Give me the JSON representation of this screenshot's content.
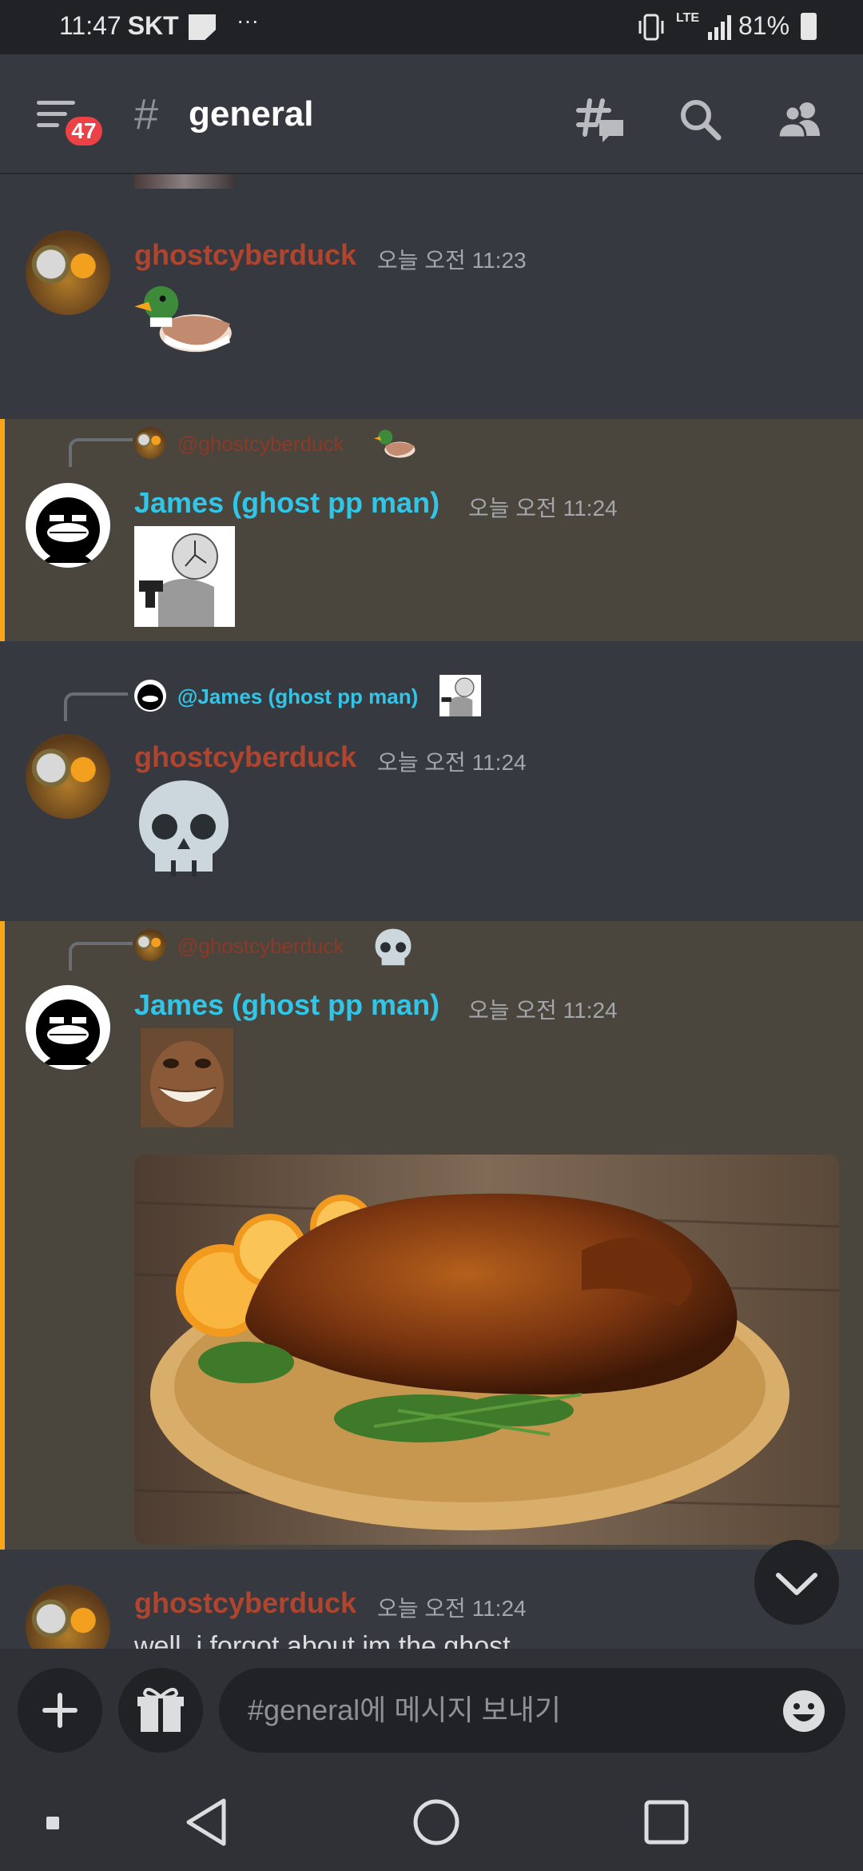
{
  "status_bar": {
    "time": "11:47",
    "carrier": "SKT",
    "more": "···",
    "network": "LTE",
    "battery": "81%"
  },
  "header": {
    "unread_badge": "47",
    "hash": "#",
    "channel": "general"
  },
  "messages": [
    {
      "author": "ghostcyberduck",
      "timestamp": "오늘 오전 11:23",
      "emoji": "🦆"
    },
    {
      "reply_to": "@ghostcyberduck",
      "author": "James (ghost pp man)",
      "timestamp": "오늘 오전 11:24"
    },
    {
      "reply_to": "@James (ghost pp man)",
      "author": "ghostcyberduck",
      "timestamp": "오늘 오전 11:24",
      "emoji": "💀"
    },
    {
      "reply_to": "@ghostcyberduck",
      "reply_emoji": "💀",
      "author": "James (ghost pp man)",
      "timestamp": "오늘 오전 11:24"
    },
    {
      "author": "ghostcyberduck",
      "timestamp": "오늘 오전 11:24",
      "text": "well, i forgot about im the ghost"
    }
  ],
  "composer": {
    "placeholder": "#general에 메시지 보내기"
  },
  "colors": {
    "background": "#36393f",
    "highlight": "#4a453d",
    "highlight_bar": "#faa61a",
    "duck_name": "#b0452f",
    "james_name": "#31c6e8",
    "badge": "#ed4245"
  }
}
